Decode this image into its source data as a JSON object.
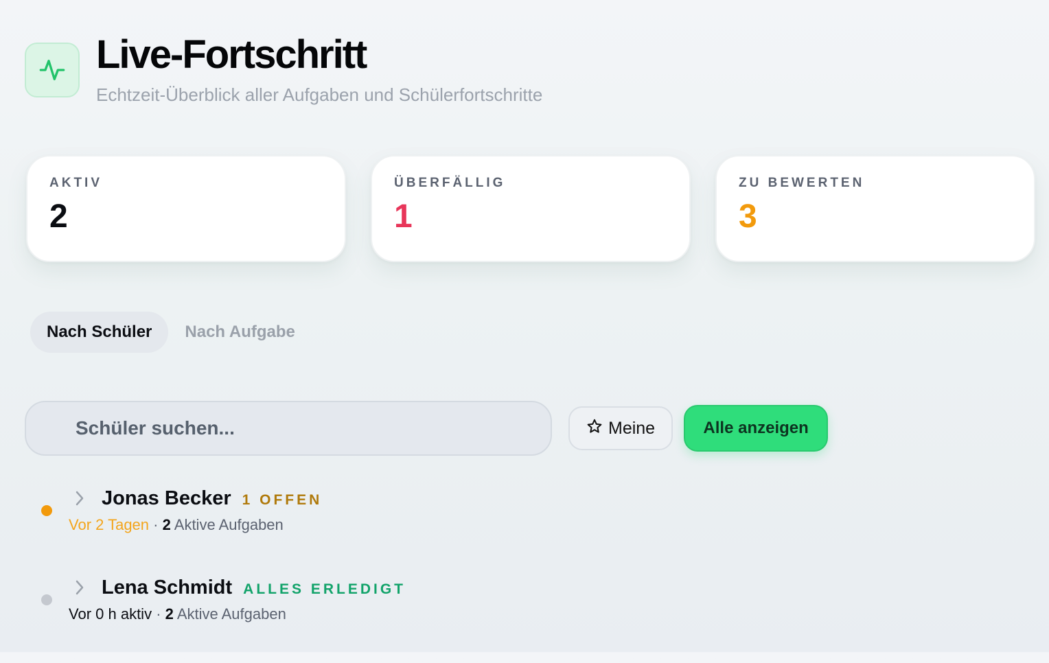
{
  "header": {
    "icon": "activity-icon",
    "title": "Live-Fortschritt",
    "subtitle": "Echtzeit-Überblick aller Aufgaben und Schülerfortschritte"
  },
  "stats": [
    {
      "label": "AKTIV",
      "value": "2",
      "color": "#0b0d12"
    },
    {
      "label": "ÜBERFÄLLIG",
      "value": "1",
      "color": "#e8365a"
    },
    {
      "label": "ZU BEWERTEN",
      "value": "3",
      "color": "#f29a0c"
    }
  ],
  "tabs": [
    {
      "label": "Nach Schüler",
      "active": true
    },
    {
      "label": "Nach Aufgabe",
      "active": false
    }
  ],
  "toolbar": {
    "search_placeholder": "Schüler suchen...",
    "meine_label": "Meine",
    "all_label": "Alle anzeigen"
  },
  "students": [
    {
      "name": "Jonas Becker",
      "badge": "1 OFFEN",
      "badge_color": "#b07a0c",
      "dot_color": "#f29a0c",
      "activity": "Vor 2 Tagen",
      "activity_color": "#f3a51c",
      "sep": "·",
      "count": "2",
      "count_label": "Aktive Aufgaben"
    },
    {
      "name": "Lena Schmidt",
      "badge": "ALLES ERLEDIGT",
      "badge_color": "#12a36a",
      "dot_color": "#c4c8cf",
      "activity": "Vor 0 h aktiv",
      "activity_color": "#0b0d12",
      "sep": "·",
      "count": "2",
      "count_label": "Aktive Aufgaben"
    }
  ]
}
